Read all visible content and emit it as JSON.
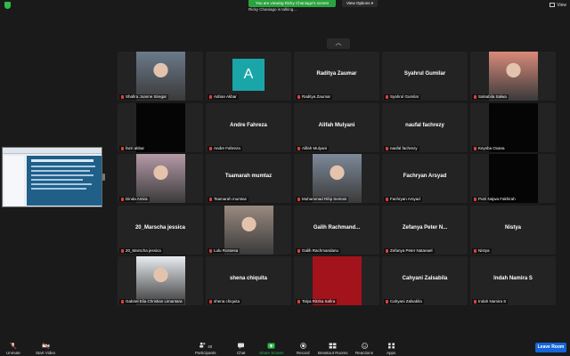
{
  "topbar": {
    "banner": "You are viewing Ricky Chaniago's screen",
    "talking": "Ricky Chaniago is talking...",
    "view_options": "View Options",
    "view": "View"
  },
  "colors": {
    "green": "#2dbc4a",
    "leave": "#1565d8",
    "tile": "#232323",
    "avatar": "#1aa6a9"
  },
  "tiles": [
    {
      "label": "Shafira Joanne Siregar",
      "big": "",
      "kind": "photo",
      "bg": "#6b7a8a"
    },
    {
      "label": "Adrian Akbar",
      "big": "A",
      "kind": "avatar"
    },
    {
      "label": "Raditya Zaumar",
      "big": "Raditya Zaumar",
      "kind": "name"
    },
    {
      "label": "Syahrul Gumilar",
      "big": "Syahrul Gumilar",
      "kind": "name"
    },
    {
      "label": "Salsabila Salwa",
      "big": "",
      "kind": "photo",
      "bg": "#d98a7a"
    },
    {
      "label": "fazri akbar",
      "big": "",
      "kind": "black"
    },
    {
      "label": "Andre Fahreza",
      "big": "Andre Fahreza",
      "kind": "name"
    },
    {
      "label": "Alifah Mulyani",
      "big": "Alifah Mulyani",
      "kind": "name"
    },
    {
      "label": "naufal fachrezy",
      "big": "naufal fachrezy",
      "kind": "name"
    },
    {
      "label": "Keysha Oxana",
      "big": "",
      "kind": "black"
    },
    {
      "label": "Dinda Amira",
      "big": "",
      "kind": "photo",
      "bg": "#b59aa8"
    },
    {
      "label": "Tsamarah mumtaz",
      "big": "Tsamarah mumtaz",
      "kind": "name"
    },
    {
      "label": "Muhammad Rifqi Sentosi",
      "big": "",
      "kind": "photo",
      "bg": "#7d8a99"
    },
    {
      "label": "Fachryan Arsyad",
      "big": "Fachryan Arsyad",
      "kind": "name"
    },
    {
      "label": "Putri Najwa Fakhirah",
      "big": "",
      "kind": "black"
    },
    {
      "label": "20_Marscha jessica",
      "big": "20_Marscha jessica",
      "kind": "name"
    },
    {
      "label": "Lulu Rossesa",
      "big": "",
      "kind": "photo",
      "bg": "#9a8a80"
    },
    {
      "label": "Galih Rachmandanu",
      "big": "Galih  Rachmand...",
      "kind": "name"
    },
    {
      "label": "Zefanya Peter Natanael",
      "big": "Zefanya  Peter  N...",
      "kind": "name"
    },
    {
      "label": "Nistya",
      "big": "Nistya",
      "kind": "name"
    },
    {
      "label": "Gabriel Elia Christian Limantara",
      "big": "",
      "kind": "photo",
      "bg": "#e8ecf0"
    },
    {
      "label": "shena chiquita",
      "big": "shena chiquita",
      "kind": "name"
    },
    {
      "label": "Talya Ritzka Safira",
      "big": "",
      "kind": "red"
    },
    {
      "label": "Cahyani Zalsabila",
      "big": "Cahyani Zalsabila",
      "kind": "name"
    },
    {
      "label": "Indah Namira S",
      "big": "Indah Namira S",
      "kind": "name"
    }
  ],
  "toolbar": {
    "unmute": "Unmute",
    "start_video": "Start Video",
    "participants": "Participants",
    "participants_count": "40",
    "chat": "Chat",
    "share_screen": "Share Screen",
    "record": "Record",
    "breakout_rooms": "Breakout Rooms",
    "reactions": "Reactions",
    "apps": "Apps",
    "leave": "Leave Room"
  }
}
